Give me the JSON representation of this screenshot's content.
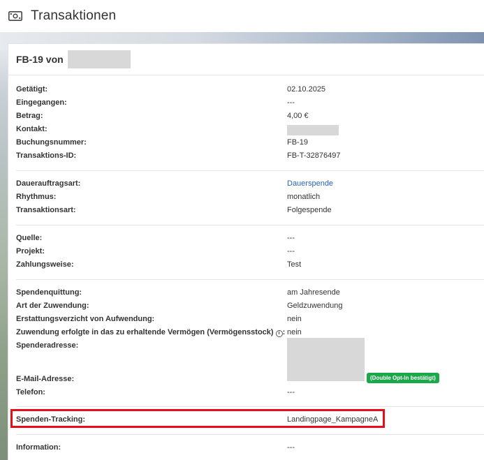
{
  "header": {
    "title": "Transaktionen",
    "icon": "money-icon"
  },
  "card": {
    "title": "FB-19 von"
  },
  "sections": [
    {
      "rows": [
        {
          "label": "Getätigt:",
          "value": "02.10.2025"
        },
        {
          "label": "Eingegangen:",
          "value": "---"
        },
        {
          "label": "Betrag:",
          "value": "4,00 €"
        },
        {
          "label": "Kontakt:",
          "value": ""
        },
        {
          "label": "Buchungsnummer:",
          "value": "FB-19"
        },
        {
          "label": "Transaktions-ID:",
          "value": "FB-T-32876497"
        }
      ]
    },
    {
      "rows": [
        {
          "label": "Dauerauftragsart:",
          "value": "Dauerspende"
        },
        {
          "label": "Rhythmus:",
          "value": "monatlich"
        },
        {
          "label": "Transaktionsart:",
          "value": "Folgespende"
        }
      ]
    },
    {
      "rows": [
        {
          "label": "Quelle:",
          "value": "---"
        },
        {
          "label": "Projekt:",
          "value": "---"
        },
        {
          "label": "Zahlungsweise:",
          "value": "Test"
        }
      ]
    },
    {
      "rows": [
        {
          "label": "Spendenquittung:",
          "value": "am Jahresende"
        },
        {
          "label": "Art der Zuwendung:",
          "value": "Geldzuwendung"
        },
        {
          "label": "Erstattungsverzicht von Aufwendung:",
          "value": "nein"
        },
        {
          "label": "Zuwendung erfolgte in das zu erhaltende Vermögen (Vermögensstock)",
          "value": "nein"
        },
        {
          "label": "Spenderadresse:",
          "value": ""
        },
        {
          "label": "E-Mail-Adresse:",
          "value": ""
        },
        {
          "label": "Telefon:",
          "value": "---"
        }
      ],
      "email_badge": "(Double Opt-In bestätigt)"
    },
    {
      "rows": [
        {
          "label": "Spenden-Tracking:",
          "value": "Landingpage_KampagneA"
        }
      ]
    },
    {
      "rows": [
        {
          "label": "Information:",
          "value": "---"
        }
      ]
    }
  ],
  "colors": {
    "link": "#2a62b8",
    "badge": "#1aa84a",
    "highlight": "#e3101b"
  }
}
